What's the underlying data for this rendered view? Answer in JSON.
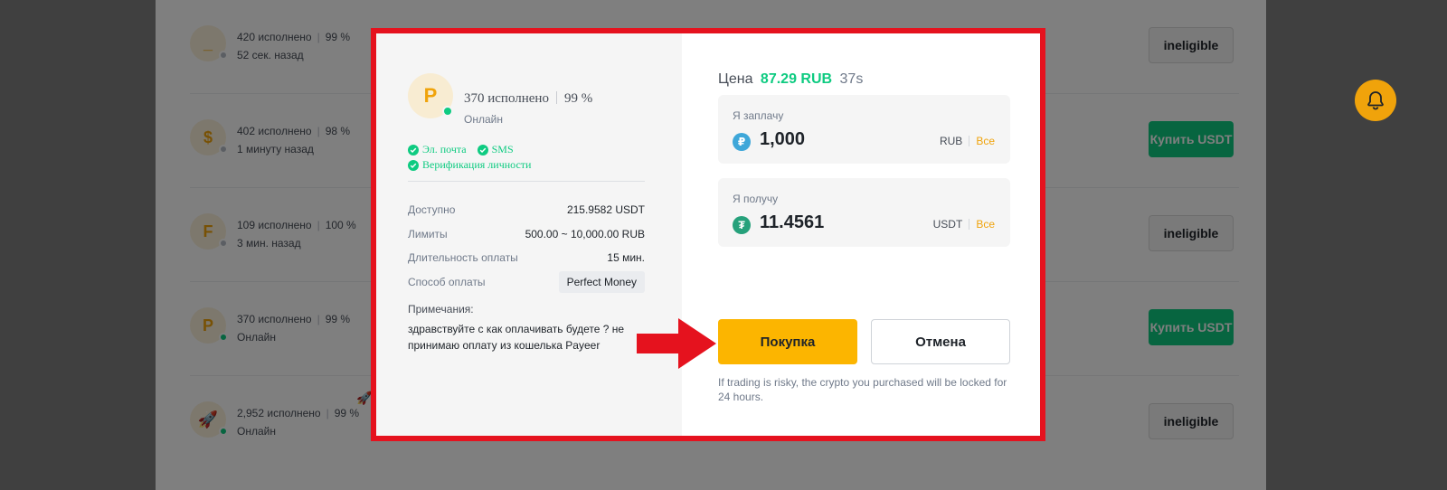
{
  "background_list": [
    {
      "avatar_letter": "_",
      "online": false,
      "completed": "420 исполнено",
      "rate": "99 %",
      "time": "52 сек. назад",
      "action": "ineligible",
      "action_type": "ineligible"
    },
    {
      "avatar_letter": "$",
      "online": false,
      "completed": "402 исполнено",
      "rate": "98 %",
      "time": "1 минуту назад",
      "action": "Купить USDT",
      "action_type": "buy"
    },
    {
      "avatar_letter": "F",
      "online": false,
      "completed": "109 исполнено",
      "rate": "100 %",
      "time": "3 мин. назад",
      "action": "ineligible",
      "action_type": "ineligible"
    },
    {
      "avatar_letter": "P",
      "online": true,
      "completed": "370 исполнено",
      "rate": "99 %",
      "time": "Онлайн",
      "action": "Купить USDT",
      "action_type": "buy"
    },
    {
      "avatar_letter": "🚀",
      "online": true,
      "completed": "2,952 исполнено",
      "rate": "99 %",
      "time": "Онлайн",
      "action": "ineligible",
      "action_type": "ineligible"
    }
  ],
  "modal": {
    "merchant": {
      "avatar_letter": "P",
      "completed": "370 исполнено",
      "rate": "99 %",
      "status": "Онлайн",
      "verifications": [
        "Эл. почта",
        "SMS",
        "Верификация личности"
      ]
    },
    "details": [
      {
        "label": "Доступно",
        "value": "215.9582 USDT"
      },
      {
        "label": "Лимиты",
        "value": "500.00 ~ 10,000.00 RUB"
      },
      {
        "label": "Длительность оплаты",
        "value": "15 мин."
      },
      {
        "label": "Способ оплаты",
        "value": "Perfect Money"
      }
    ],
    "notes_label": "Примечания:",
    "notes_text": "здравствуйте с как оплачивать будете ? не принимаю оплату из кошелька Payeer",
    "price_label": "Цена",
    "price_value": "87.29 RUB",
    "price_timer": "37s",
    "pay": {
      "label": "Я заплачу",
      "amount": "1,000",
      "currency": "RUB",
      "all": "Все",
      "coin_symbol": "₽"
    },
    "receive": {
      "label": "Я получу",
      "amount": "11.4561",
      "currency": "USDT",
      "all": "Все",
      "coin_symbol": "₮"
    },
    "buy_button": "Покупка",
    "cancel_button": "Отмена",
    "risk_note": "If trading is risky, the crypto you purchased will be locked for 24 hours."
  },
  "colors": {
    "accent_yellow": "#fcb500",
    "green": "#0ecb81",
    "highlight_red": "#e5121e",
    "rub_coin": "#3ea7d9",
    "usdt_coin": "#26a17b"
  },
  "icons": {
    "bell": "bell-icon",
    "check": "check-circle-icon",
    "arrow": "red-arrow-annotation"
  }
}
